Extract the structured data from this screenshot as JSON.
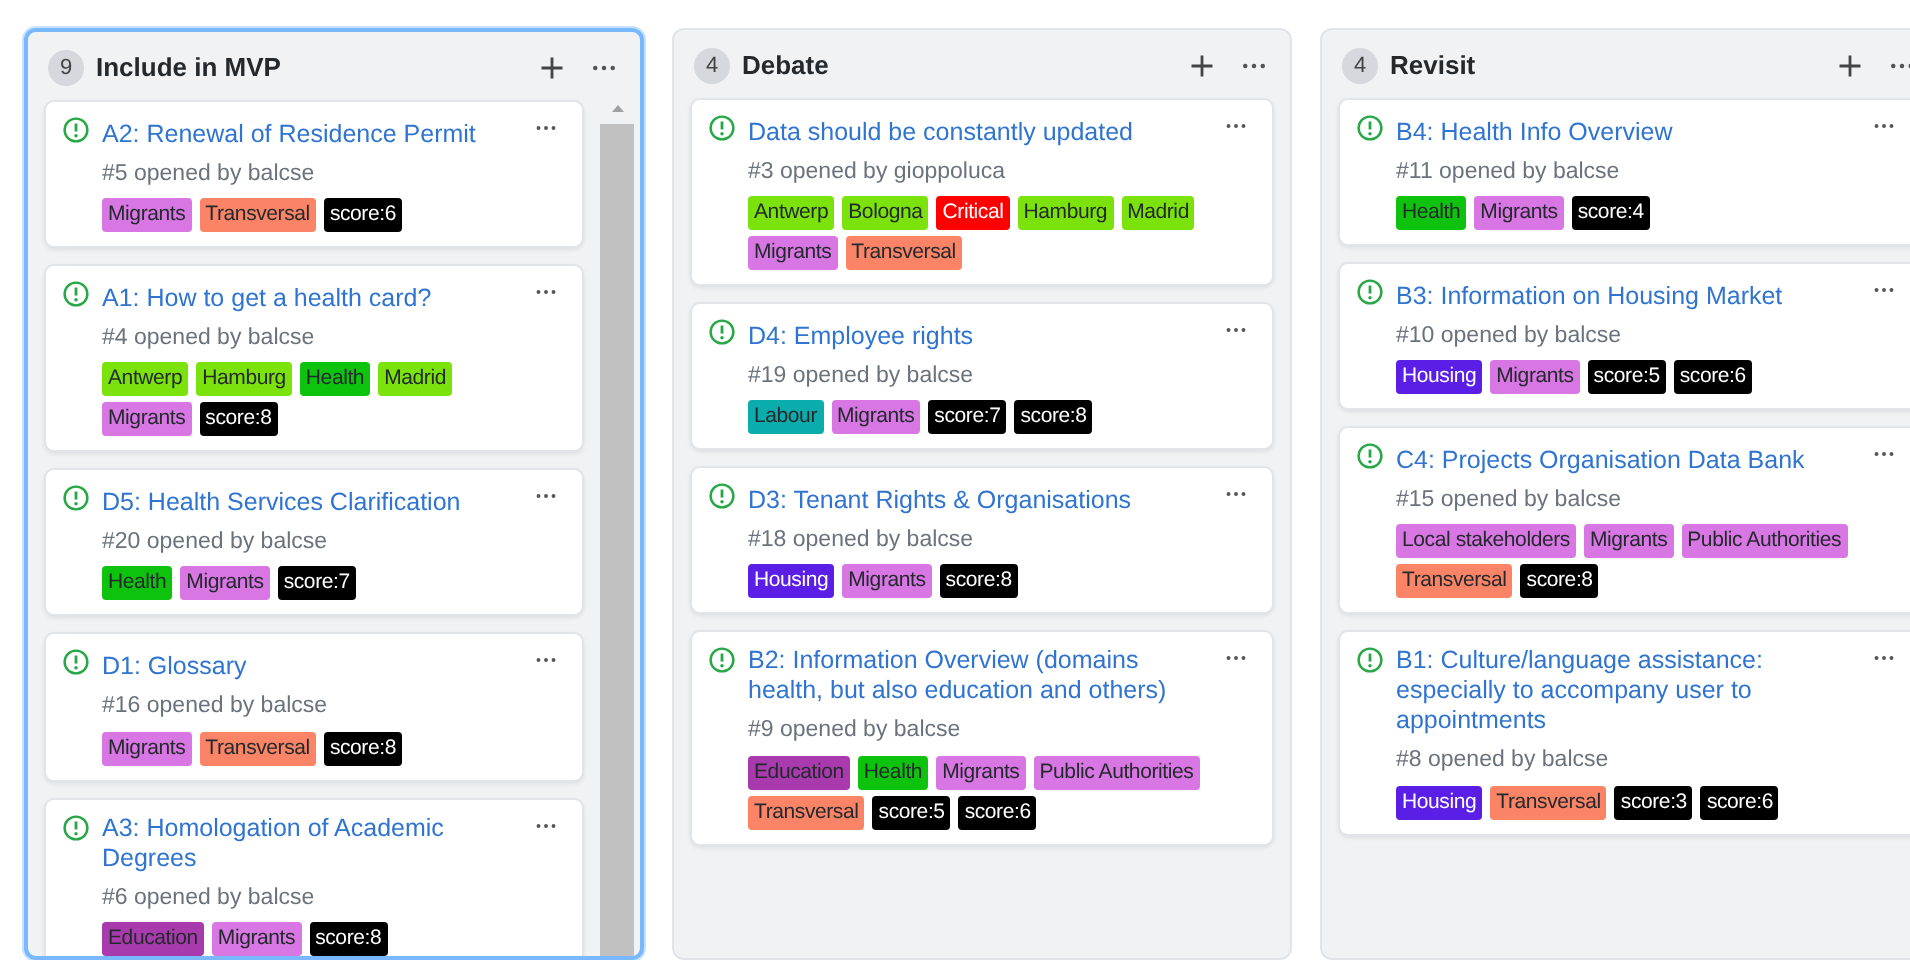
{
  "columns": [
    {
      "count": "9",
      "title": "Include in MVP",
      "selected": true,
      "scrollable": true,
      "cards": [
        {
          "title": "A2: Renewal of Residence Permit",
          "meta": "#5 opened by balcse",
          "labels": [
            {
              "name": "Migrants",
              "color": "#d876e3"
            },
            {
              "name": "Transversal",
              "color": "#fb8466"
            },
            {
              "name": "score:6",
              "color": "#000000"
            }
          ]
        },
        {
          "title": "A1: How to get a health card?",
          "meta": "#4 opened by balcse",
          "labels": [
            {
              "name": "Antwerp",
              "color": "#7be30b"
            },
            {
              "name": "Hamburg",
              "color": "#7be30b"
            },
            {
              "name": "Health",
              "color": "#0ec30e"
            },
            {
              "name": "Madrid",
              "color": "#7be30b"
            },
            {
              "name": "Migrants",
              "color": "#d876e3"
            },
            {
              "name": "score:8",
              "color": "#000000"
            }
          ]
        },
        {
          "title": "D5: Health Services Clarification",
          "meta": "#20 opened by balcse",
          "labels": [
            {
              "name": "Health",
              "color": "#0ec30e"
            },
            {
              "name": "Migrants",
              "color": "#d876e3"
            },
            {
              "name": "score:7",
              "color": "#000000"
            }
          ]
        },
        {
          "title": "D1: Glossary",
          "meta": "#16 opened by balcse",
          "labels": [
            {
              "name": "Migrants",
              "color": "#d876e3"
            },
            {
              "name": "Transversal",
              "color": "#fb8466"
            },
            {
              "name": "score:8",
              "color": "#000000"
            }
          ]
        },
        {
          "title": "A3: Homologation of Academic Degrees",
          "meta": "#6 opened by balcse",
          "labels": [
            {
              "name": "Education",
              "color": "#a93aad"
            },
            {
              "name": "Migrants",
              "color": "#d876e3"
            },
            {
              "name": "score:8",
              "color": "#000000"
            }
          ]
        }
      ]
    },
    {
      "count": "4",
      "title": "Debate",
      "selected": false,
      "scrollable": false,
      "cards": [
        {
          "title": "Data should be constantly updated",
          "meta": "#3 opened by gioppoluca",
          "labels": [
            {
              "name": "Antwerp",
              "color": "#7be30b"
            },
            {
              "name": "Bologna",
              "color": "#7be30b"
            },
            {
              "name": "Critical",
              "color": "#ff0000"
            },
            {
              "name": "Hamburg",
              "color": "#7be30b"
            },
            {
              "name": "Madrid",
              "color": "#7be30b"
            },
            {
              "name": "Migrants",
              "color": "#d876e3"
            },
            {
              "name": "Transversal",
              "color": "#fb8466"
            }
          ]
        },
        {
          "title": "D4: Employee rights",
          "meta": "#19 opened by balcse",
          "labels": [
            {
              "name": "Labour",
              "color": "#0aacac"
            },
            {
              "name": "Migrants",
              "color": "#d876e3"
            },
            {
              "name": "score:7",
              "color": "#000000"
            },
            {
              "name": "score:8",
              "color": "#000000"
            }
          ]
        },
        {
          "title": "D3: Tenant Rights & Organisations",
          "meta": "#18 opened by balcse",
          "labels": [
            {
              "name": "Housing",
              "color": "#5a1ee6"
            },
            {
              "name": "Migrants",
              "color": "#d876e3"
            },
            {
              "name": "score:8",
              "color": "#000000"
            }
          ]
        },
        {
          "title": "B2: Information Overview (domains health, but also education and others)",
          "meta": "#9 opened by balcse",
          "labels": [
            {
              "name": "Education",
              "color": "#a93aad"
            },
            {
              "name": "Health",
              "color": "#0ec30e"
            },
            {
              "name": "Migrants",
              "color": "#d876e3"
            },
            {
              "name": "Public Authorities",
              "color": "#d876e3"
            },
            {
              "name": "Transversal",
              "color": "#fb8466"
            },
            {
              "name": "score:5",
              "color": "#000000"
            },
            {
              "name": "score:6",
              "color": "#000000"
            }
          ]
        }
      ]
    },
    {
      "count": "4",
      "title": "Revisit",
      "selected": false,
      "scrollable": false,
      "cards": [
        {
          "title": "B4: Health Info Overview",
          "meta": "#11 opened by balcse",
          "labels": [
            {
              "name": "Health",
              "color": "#0ec30e"
            },
            {
              "name": "Migrants",
              "color": "#d876e3"
            },
            {
              "name": "score:4",
              "color": "#000000"
            }
          ]
        },
        {
          "title": "B3: Information on Housing Market",
          "meta": "#10 opened by balcse",
          "labels": [
            {
              "name": "Housing",
              "color": "#5a1ee6"
            },
            {
              "name": "Migrants",
              "color": "#d876e3"
            },
            {
              "name": "score:5",
              "color": "#000000"
            },
            {
              "name": "score:6",
              "color": "#000000"
            }
          ]
        },
        {
          "title": "C4: Projects Organisation Data Bank",
          "meta": "#15 opened by balcse",
          "labels": [
            {
              "name": "Local stakeholders",
              "color": "#d876e3"
            },
            {
              "name": "Migrants",
              "color": "#d876e3"
            },
            {
              "name": "Public Authorities",
              "color": "#d876e3"
            },
            {
              "name": "Transversal",
              "color": "#fb8466"
            },
            {
              "name": "score:8",
              "color": "#000000"
            }
          ]
        },
        {
          "title": "B1: Culture/language assistance: especially to accompany user to appointments",
          "meta": "#8 opened by balcse",
          "labels": [
            {
              "name": "Housing",
              "color": "#5a1ee6"
            },
            {
              "name": "Transversal",
              "color": "#fb8466"
            },
            {
              "name": "score:3",
              "color": "#000000"
            },
            {
              "name": "score:6",
              "color": "#000000"
            }
          ]
        }
      ]
    }
  ]
}
